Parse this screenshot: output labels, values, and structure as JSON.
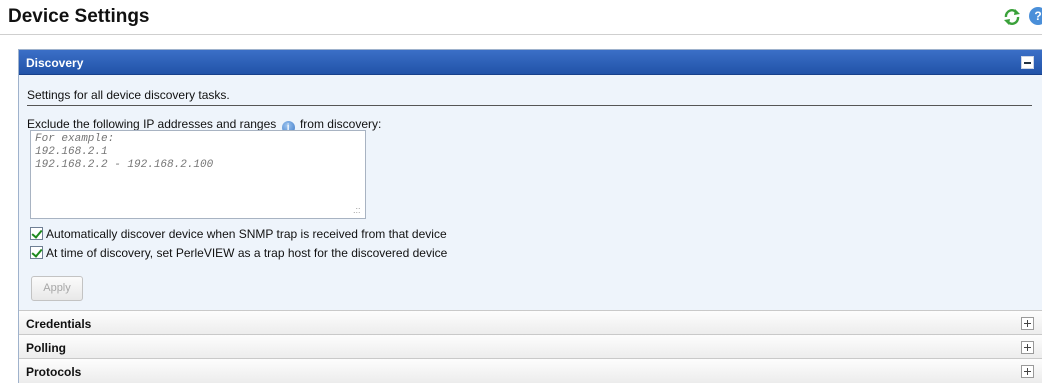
{
  "header": {
    "title": "Device Settings",
    "refresh_icon": "refresh-icon",
    "help_icon": "help-icon",
    "help_glyph": "?"
  },
  "discovery": {
    "title": "Discovery",
    "description": "Settings for all device discovery tasks.",
    "exclude_label_before": "Exclude the following IP addresses and ranges",
    "exclude_label_after": "from discovery:",
    "info_glyph": "i",
    "exclude_textarea": {
      "value": "",
      "placeholder": "For example:\n192.168.2.1\n192.168.2.2 - 192.168.2.100"
    },
    "checkbox_snmp": {
      "label": "Automatically discover device when SNMP trap is received from that device",
      "checked": true
    },
    "checkbox_trap_host": {
      "label": "At time of discovery, set PerleVIEW as a trap host for the discovered device",
      "checked": true
    },
    "apply_label": "Apply"
  },
  "sections": {
    "credentials": "Credentials",
    "polling": "Polling",
    "protocols": "Protocols"
  },
  "colors": {
    "discovery_header": "#2d5fb8",
    "body_background": "#eef4fb",
    "checkmark": "#1e8a1e"
  }
}
